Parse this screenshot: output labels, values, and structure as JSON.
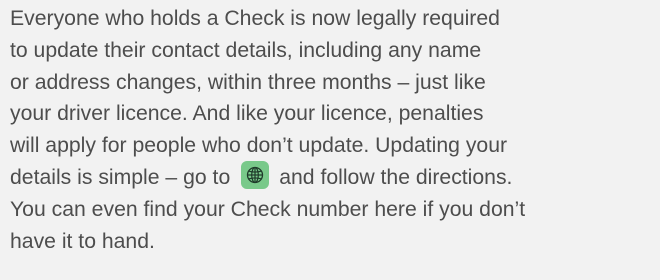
{
  "paragraph": {
    "line1": "Everyone who holds a Check is now legally required",
    "line2": "to update their contact details, including any name",
    "line3": "or address changes, within three months – just like",
    "line4": "your driver licence. And like your licence, penalties",
    "line5": "will apply for people who don’t update. Updating your",
    "line6_before_icon": "details is simple – go to",
    "line6_after_icon": "and follow the directions.",
    "line7": "You can even find your Check number here if you don’t",
    "line8": "have it to hand."
  },
  "icons": {
    "inline_icon": "globe-icon",
    "icon_background": "#79c98a",
    "icon_stroke": "#1f3a2a"
  },
  "colors": {
    "background": "#f2f2f2",
    "text": "#4d4d4d"
  }
}
